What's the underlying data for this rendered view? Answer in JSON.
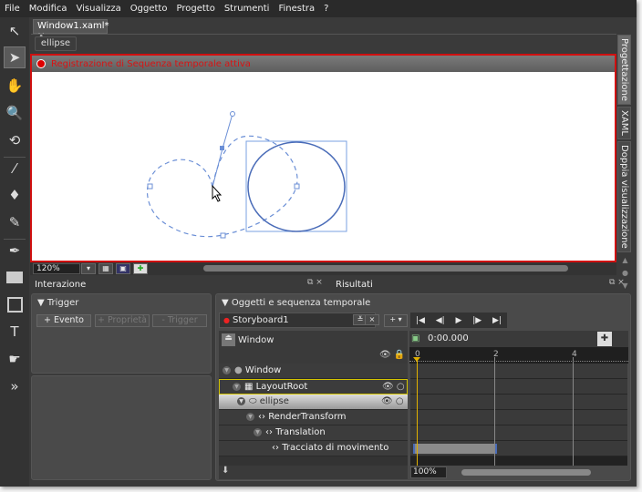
{
  "menu": [
    "File",
    "Modifica",
    "Visualizza",
    "Oggetto",
    "Progetto",
    "Strumenti",
    "Finestra",
    "?"
  ],
  "document": {
    "tab": "Window1.xaml*",
    "breadcrumb": "ellipse",
    "recording": "Registrazione di Sequenza temporale attiva",
    "zoom": "120%"
  },
  "view_tabs": [
    "Progettazione",
    "XAML",
    "Doppia visualizzazione"
  ],
  "interaction": {
    "title": "Interazione",
    "trigger": "Trigger",
    "buttons": [
      "+ Evento",
      "+ Proprietà",
      "- Trigger"
    ]
  },
  "results": {
    "title": "Risultati"
  },
  "objects": {
    "title": "Oggetti e sequenza temporale",
    "storyboard": "Storyboard1",
    "scope": "Window",
    "time": "0:00.000",
    "tree": [
      "Window",
      "LayoutRoot",
      "ellipse",
      "RenderTransform",
      "Translation",
      "Tracciato di movimento"
    ],
    "ruler": [
      "0",
      "2",
      "4"
    ],
    "timeline_zoom": "100%"
  },
  "colors": {
    "record": "#d01010",
    "selection": "#5a7fd0",
    "playhead": "#e0b000"
  }
}
